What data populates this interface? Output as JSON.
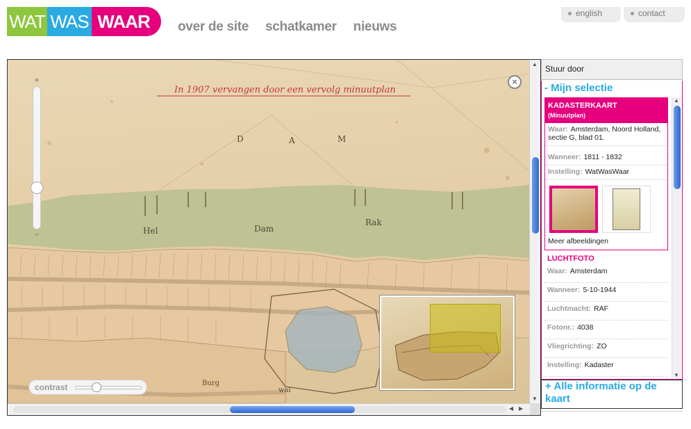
{
  "logo": {
    "part1": "WAT",
    "part2": "WAS",
    "part3": "WAAR"
  },
  "nav": {
    "items": [
      "over de site",
      "schatkamer",
      "nieuws"
    ]
  },
  "toplinks": {
    "english": "english",
    "contact": "contact"
  },
  "map": {
    "title_annotation": "In 1907 vervangen door een vervolg minuutplan",
    "labels": [
      "D",
      "A",
      "M",
      "Hel",
      "Dam",
      "Rak",
      "Burg",
      "wal"
    ],
    "zoom_plus": "+",
    "zoom_minus": "−",
    "close_symbol": "×",
    "contrast_label": "contrast"
  },
  "sidebar": {
    "stuur_door": "Stuur door",
    "selection_title": "- Mijn selectie",
    "card1": {
      "title": "KADASTERKAART",
      "subtitle": "(Minuutplan)",
      "waar_label": "Waar:",
      "waar_value": "Amsterdam, Noord Holland, sectie G, blad 01.",
      "wanneer_label": "Wanneer:",
      "wanneer_value": "1811 - 1832",
      "instelling_label": "Instelling:",
      "instelling_value": "WatWasWaar",
      "meer": "Meer afbeeldingen"
    },
    "card2": {
      "title": "LUCHTFOTO",
      "waar_label": "Waar:",
      "waar_value": "Amsterdam",
      "wanneer_label": "Wanneer:",
      "wanneer_value": "5-10-1944",
      "luchtmacht_label": "Luchtmacht:",
      "luchtmacht_value": "RAF",
      "fotonr_label": "Fotonr.:",
      "fotonr_value": "4038",
      "vliegrichting_label": "Vliegrichting:",
      "vliegrichting_value": "ZO",
      "instelling_label": "Instelling:",
      "instelling_value": "Kadaster"
    },
    "alle_info": "+ Alle informatie op de kaart"
  },
  "colors": {
    "green": "#8ec63f",
    "blue": "#29aae1",
    "magenta": "#e6007e",
    "nav_gray": "#8b8b8b"
  }
}
